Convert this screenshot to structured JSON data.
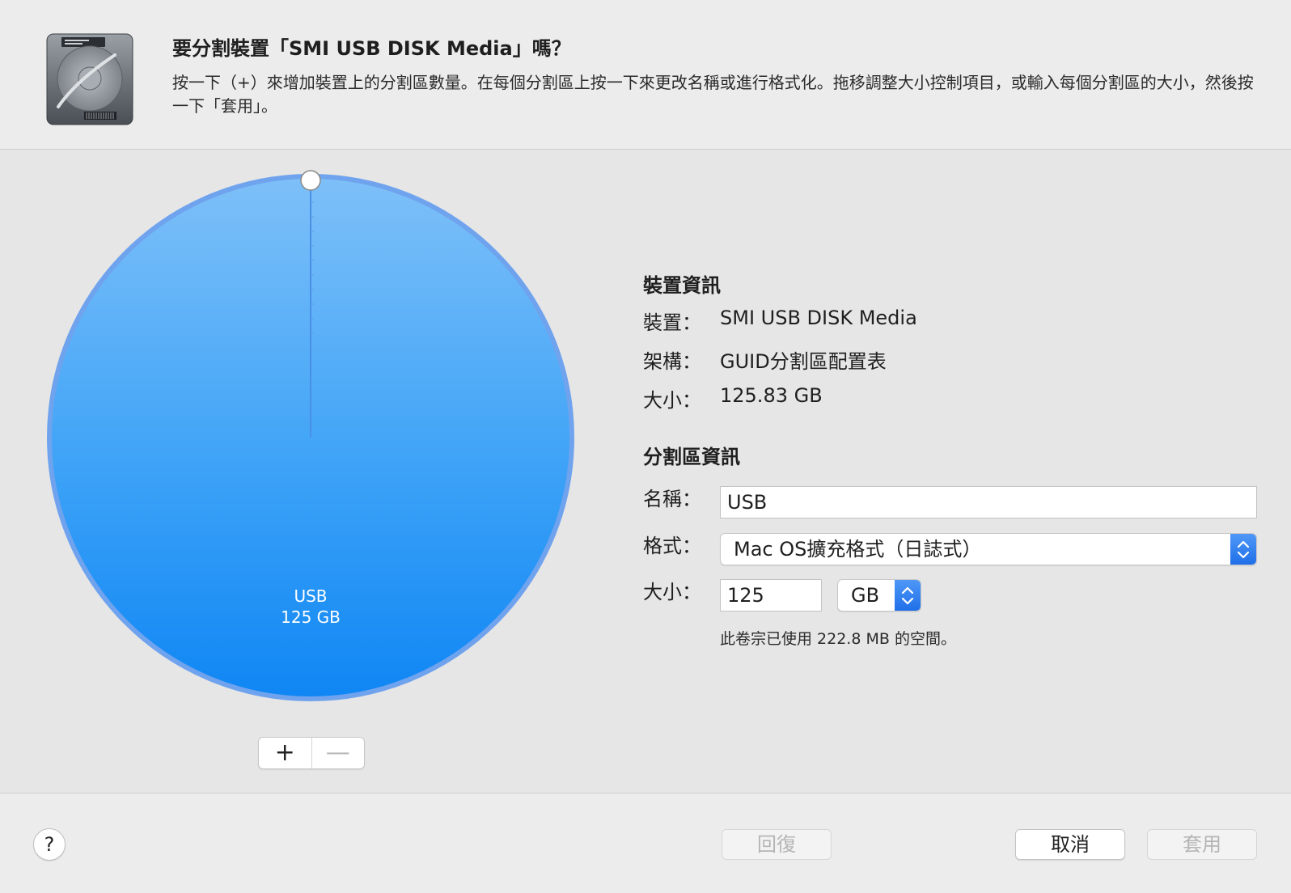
{
  "header": {
    "title": "要分割裝置「SMI USB DISK Media」嗎？",
    "description": "按一下（+）來增加裝置上的分割區數量。在每個分割區上按一下來更改名稱或進行格式化。拖移調整大小控制項目，或輸入每個分割區的大小，然後按一下「套用」。"
  },
  "pie": {
    "partition_name": "USB",
    "partition_size": "125 GB",
    "fill_fraction": 1.0,
    "color": "#2f9bf6"
  },
  "controls": {
    "add_label": "+",
    "remove_label": "—"
  },
  "device_info": {
    "section_title": "裝置資訊",
    "device_label": "裝置：",
    "device_value": "SMI USB DISK Media",
    "scheme_label": "架構：",
    "scheme_value": "GUID分割區配置表",
    "size_label": "大小：",
    "size_value": "125.83 GB"
  },
  "partition_info": {
    "section_title": "分割區資訊",
    "name_label": "名稱：",
    "name_value": "USB",
    "format_label": "格式：",
    "format_value": "Mac OS擴充格式（日誌式）",
    "size_label": "大小：",
    "size_value": "125",
    "size_unit": "GB",
    "note": "此卷宗已使用 222.8 MB 的空間。"
  },
  "footer": {
    "help_label": "?",
    "revert_label": "回復",
    "cancel_label": "取消",
    "apply_label": "套用"
  }
}
